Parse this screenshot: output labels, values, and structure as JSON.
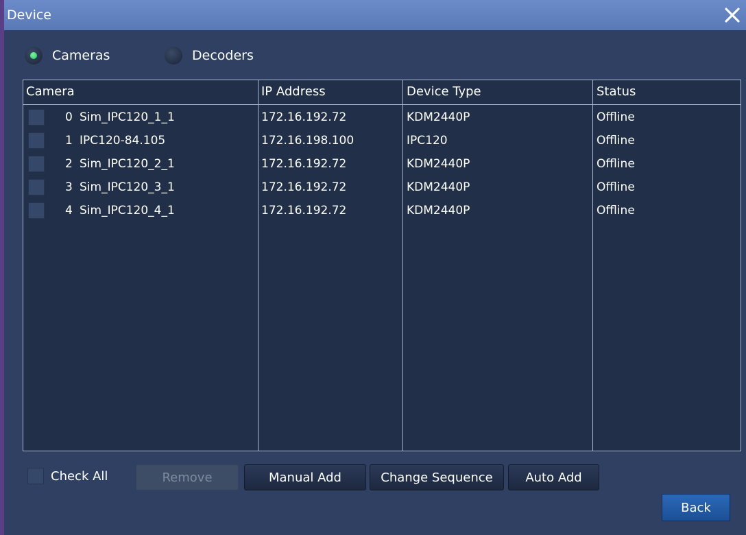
{
  "window": {
    "title": "Device"
  },
  "tabs": [
    {
      "label": "Cameras",
      "selected": true
    },
    {
      "label": "Decoders",
      "selected": false
    }
  ],
  "table": {
    "columns": [
      "Camera",
      "IP Address",
      "Device Type",
      "Status"
    ],
    "rows": [
      {
        "index": "0",
        "name": "Sim_IPC120_1_1",
        "ip": "172.16.192.72",
        "type": "KDM2440P",
        "status": "Offline"
      },
      {
        "index": "1",
        "name": "IPC120-84.105",
        "ip": "172.16.198.100",
        "type": "IPC120",
        "status": "Offline"
      },
      {
        "index": "2",
        "name": "Sim_IPC120_2_1",
        "ip": "172.16.192.72",
        "type": "KDM2440P",
        "status": "Offline"
      },
      {
        "index": "3",
        "name": "Sim_IPC120_3_1",
        "ip": "172.16.192.72",
        "type": "KDM2440P",
        "status": "Offline"
      },
      {
        "index": "4",
        "name": "Sim_IPC120_4_1",
        "ip": "172.16.192.72",
        "type": "KDM2440P",
        "status": "Offline"
      }
    ]
  },
  "bottom": {
    "check_all_label": "Check All",
    "remove_label": "Remove",
    "manual_add_label": "Manual Add",
    "change_sequence_label": "Change Sequence",
    "auto_add_label": "Auto Add",
    "back_label": "Back"
  },
  "icons": {
    "close": "close-icon",
    "radio": "radio-icon",
    "checkbox": "checkbox-icon"
  },
  "colors": {
    "radio_selected": "#22c860",
    "title_bar": "#6283c0",
    "back_button": "#2260ad"
  }
}
